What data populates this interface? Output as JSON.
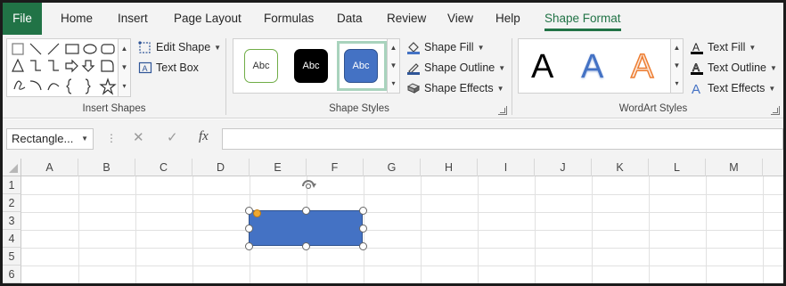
{
  "ribbon_tabs": [
    {
      "label": "File"
    },
    {
      "label": "Home"
    },
    {
      "label": "Insert"
    },
    {
      "label": "Page Layout"
    },
    {
      "label": "Formulas"
    },
    {
      "label": "Data"
    },
    {
      "label": "Review"
    },
    {
      "label": "View"
    },
    {
      "label": "Help"
    },
    {
      "label": "Shape Format",
      "active": true
    }
  ],
  "insert_shapes": {
    "group_label": "Insert Shapes",
    "edit_shape_label": "Edit Shape",
    "text_box_label": "Text Box"
  },
  "shape_styles": {
    "group_label": "Shape Styles",
    "thumb_label": "Abc",
    "fill_label": "Shape Fill",
    "outline_label": "Shape Outline",
    "effects_label": "Shape Effects"
  },
  "wordart_styles": {
    "group_label": "WordArt Styles",
    "sample_letter": "A",
    "text_fill_label": "Text Fill",
    "text_outline_label": "Text Outline",
    "text_effects_label": "Text Effects"
  },
  "formula_bar": {
    "name_box": "Rectangle...",
    "cancel_symbol": "✕",
    "enter_symbol": "✓",
    "fx_symbol": "fx",
    "formula": ""
  },
  "grid": {
    "columns": [
      "A",
      "B",
      "C",
      "D",
      "E",
      "F",
      "G",
      "H",
      "I",
      "J",
      "K",
      "L",
      "M"
    ],
    "rows": [
      "1",
      "2",
      "3",
      "4",
      "5",
      "6"
    ]
  },
  "colors": {
    "accent": "#217346",
    "shape_fill": "#4472c4",
    "wordart_blue": "#4472c4",
    "wordart_orange": "#ed7d31"
  }
}
